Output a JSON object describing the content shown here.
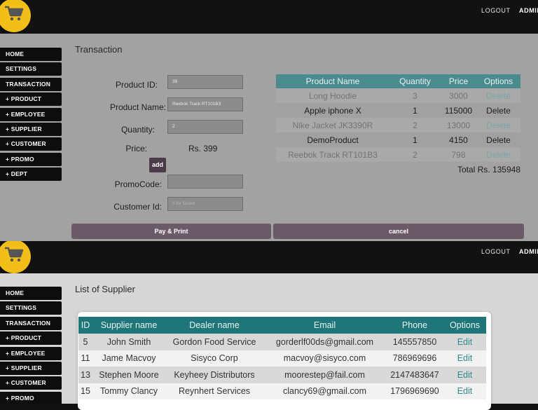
{
  "header": {
    "logout_label": "LOGOUT",
    "admin_label": "ADMIN"
  },
  "sidebar": {
    "items": [
      {
        "label": "HOME"
      },
      {
        "label": "SETTINGS"
      },
      {
        "label": "TRANSACTION"
      },
      {
        "label": "+ PRODUCT"
      },
      {
        "label": "+ EMPLOYEE"
      },
      {
        "label": "+ SUPPLIER"
      },
      {
        "label": "+ CUSTOMER"
      },
      {
        "label": "+ PROMO"
      },
      {
        "label": "+ DEPT"
      }
    ]
  },
  "transaction": {
    "title": "Transaction",
    "product_id_label": "Product ID:",
    "product_id_value": "39",
    "product_name_label": "Product Name:",
    "product_name_value": "Reebok Track RT101B3",
    "quantity_label": "Quantity:",
    "quantity_value": "2",
    "price_label": "Price:",
    "price_value": "Rs. 399",
    "add_label": "add",
    "promo_label": "PromoCode:",
    "promo_value": "",
    "customer_label": "Customer Id:",
    "customer_placeholder": "0 for Guest",
    "pay_label": "Pay & Print",
    "cancel_label": "cancel",
    "cart": {
      "headers": [
        "Product Name",
        "Quantity",
        "Price",
        "Options"
      ],
      "rows": [
        {
          "name": "Long Hoodie",
          "qty": "3",
          "price": "3000",
          "option": "Delete"
        },
        {
          "name": "Apple iphone X",
          "qty": "1",
          "price": "115000",
          "option": "Delete"
        },
        {
          "name": "Nike Jacket JK3390R",
          "qty": "2",
          "price": "13000",
          "option": "Delete"
        },
        {
          "name": "DemoProduct",
          "qty": "1",
          "price": "4150",
          "option": "Delete"
        },
        {
          "name": "Reebok Track RT101B3",
          "qty": "2",
          "price": "798",
          "option": "Delete"
        }
      ]
    },
    "total": "Total Rs. 135948"
  },
  "suppliers": {
    "title": "List of Supplier",
    "headers": [
      "ID",
      "Supplier name",
      "Dealer name",
      "Email",
      "Phone",
      "Options"
    ],
    "rows": [
      {
        "id": "5",
        "supplier": "John Smith",
        "dealer": "Gordon Food Service",
        "email": "gorderlf00ds@gmail.com",
        "phone": "145557850",
        "option": "Edit"
      },
      {
        "id": "11",
        "supplier": "Jame Macvoy",
        "dealer": "Sisyco Corp",
        "email": "macvoy@sisyco.com",
        "phone": "786969696",
        "option": "Edit"
      },
      {
        "id": "13",
        "supplier": "Stephen Moore",
        "dealer": "Keyheey Distributors",
        "email": "moorestep@fail.com",
        "phone": "2147483647",
        "option": "Edit"
      },
      {
        "id": "15",
        "supplier": "Tommy Clancy",
        "dealer": "Reynhert Services",
        "email": "clancy69@gmail.com",
        "phone": "1796969690",
        "option": "Edit"
      }
    ]
  },
  "colors": {
    "logo": "#f1bf17",
    "cart_header": "#4a8b8d",
    "supplier_header": "#1f7679",
    "button": "#6b5b68"
  }
}
